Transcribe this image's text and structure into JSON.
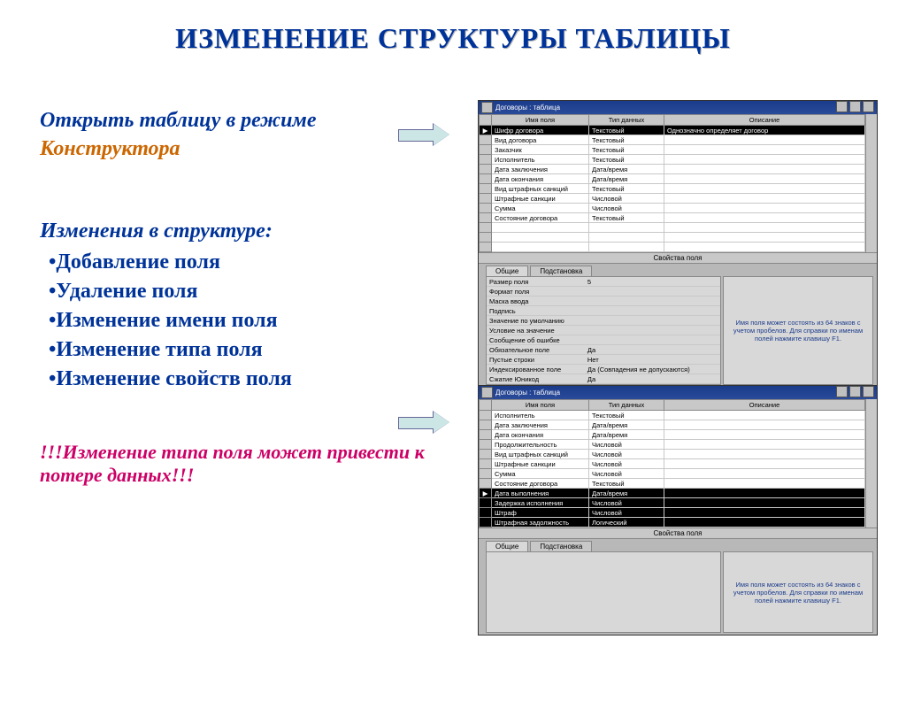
{
  "title": "ИЗМЕНЕНИЕ СТРУКТУРЫ ТАБЛИЦЫ",
  "left": {
    "line1a": "Открыть таблицу в режиме",
    "line1b": "Конструктора",
    "section2": "Изменения в структуре:",
    "bullets": [
      "Добавление поля",
      "Удаление поля",
      "Изменение имени поля",
      "Изменение типа поля",
      "Изменение свойств поля"
    ],
    "warning": "!!!Изменение типа поля может привести к потере данных!!!"
  },
  "win1": {
    "title": "Договоры : таблица",
    "cols": [
      "Имя поля",
      "Тип данных",
      "Описание"
    ],
    "rows": [
      {
        "name": "Шифр договора",
        "type": "Текстовый",
        "desc": "Однозначно определяет договор",
        "key": true,
        "sel": true
      },
      {
        "name": "Вид договора",
        "type": "Текстовый",
        "desc": ""
      },
      {
        "name": "Заказчик",
        "type": "Текстовый",
        "desc": ""
      },
      {
        "name": "Исполнитель",
        "type": "Текстовый",
        "desc": ""
      },
      {
        "name": "Дата заключения",
        "type": "Дата/время",
        "desc": ""
      },
      {
        "name": "Дата окончания",
        "type": "Дата/время",
        "desc": ""
      },
      {
        "name": "Вид штрафных санкций",
        "type": "Текстовый",
        "desc": ""
      },
      {
        "name": "Штрафные санкции",
        "type": "Числовой",
        "desc": ""
      },
      {
        "name": "Сумма",
        "type": "Числовой",
        "desc": ""
      },
      {
        "name": "Состояние договора",
        "type": "Текстовый",
        "desc": ""
      }
    ],
    "propsHeader": "Свойства поля",
    "tabs": [
      "Общие",
      "Подстановка"
    ],
    "props": [
      [
        "Размер поля",
        "5"
      ],
      [
        "Формат поля",
        ""
      ],
      [
        "Маска ввода",
        ""
      ],
      [
        "Подпись",
        ""
      ],
      [
        "Значение по умолчанию",
        ""
      ],
      [
        "Условие на значение",
        ""
      ],
      [
        "Сообщение об ошибке",
        ""
      ],
      [
        "Обязательное поле",
        "Да"
      ],
      [
        "Пустые строки",
        "Нет"
      ],
      [
        "Индексированное поле",
        "Да (Совпадения не допускаются)"
      ],
      [
        "Сжатие Юникод",
        "Да"
      ]
    ],
    "help": "Имя поля может состоять из 64 знаков с учетом пробелов. Для справки по именам полей нажмите клавишу F1."
  },
  "win2": {
    "title": "Договоры : таблица",
    "cols": [
      "Имя поля",
      "Тип данных",
      "Описание"
    ],
    "rows": [
      {
        "name": "Исполнитель",
        "type": "Текстовый",
        "desc": ""
      },
      {
        "name": "Дата заключения",
        "type": "Дата/время",
        "desc": ""
      },
      {
        "name": "Дата окончания",
        "type": "Дата/время",
        "desc": ""
      },
      {
        "name": "Продолжительность",
        "type": "Числовой",
        "desc": ""
      },
      {
        "name": "Вид штрафных санкций",
        "type": "Числовой",
        "desc": ""
      },
      {
        "name": "Штрафные санкции",
        "type": "Числовой",
        "desc": ""
      },
      {
        "name": "Сумма",
        "type": "Числовой",
        "desc": ""
      },
      {
        "name": "Состояние договора",
        "type": "Текстовый",
        "desc": ""
      },
      {
        "name": "Дата выполнения",
        "type": "Дата/время",
        "desc": "",
        "sel": true
      },
      {
        "name": "Задержка исполнения",
        "type": "Числовой",
        "desc": "",
        "sel": true
      },
      {
        "name": "Штраф",
        "type": "Числовой",
        "desc": "",
        "sel": true
      },
      {
        "name": "Штрафная задолжность",
        "type": "Логический",
        "desc": "",
        "sel": true
      }
    ],
    "propsHeader": "Свойства поля",
    "tabs": [
      "Общие",
      "Подстановка"
    ],
    "help": "Имя поля может состоять из 64 знаков с учетом пробелов. Для справки по именам полей нажмите клавишу F1."
  }
}
